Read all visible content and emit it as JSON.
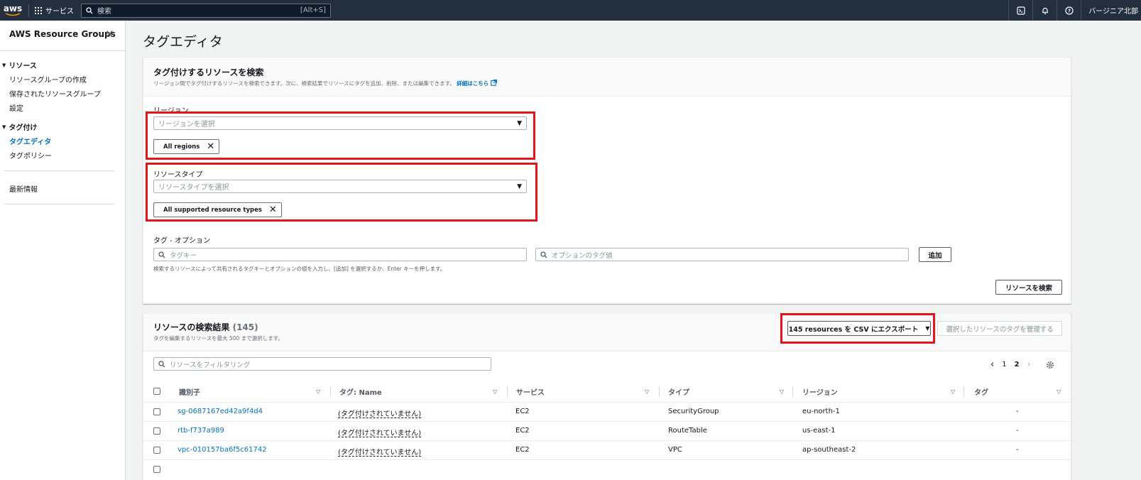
{
  "topnav": {
    "logo": "aws",
    "services_label": "サービス",
    "search_placeholder": "検索",
    "search_shortcut": "[Alt+S]",
    "region": "バージニア北部"
  },
  "sidebar": {
    "title": "AWS Resource Groups",
    "section1": "リソース",
    "items1": [
      "リソースグループの作成",
      "保存されたリソースグループ",
      "設定"
    ],
    "section2": "タグ付け",
    "items2": [
      "タグエディタ",
      "タグポリシー"
    ],
    "extra": "最新情報"
  },
  "page_title": "タグエディタ",
  "search_panel": {
    "title": "タグ付けするリソースを検索",
    "desc": "リージョン間でタグ付けするリソースを検索できます。次に、検索結果でリソースにタグを追加、削除、または編集できます。",
    "desc_link": "詳細はこちら",
    "region_label": "リージョン",
    "region_placeholder": "リージョンを選択",
    "region_token": "All regions",
    "rtype_label": "リソースタイプ",
    "rtype_placeholder": "リソースタイプを選択",
    "rtype_token": "All supported resource types",
    "tag_label": "タグ - オプション",
    "tag_key_placeholder": "タグキー",
    "tag_value_placeholder": "オプションのタグ値",
    "add_button": "追加",
    "tag_hint": "検索するリソースによって共有されるタグキーとオプションの値を入力し、[追加] を選択するか、Enter キーを押します。",
    "search_button": "リソースを検索"
  },
  "results_panel": {
    "title": "リソースの検索結果",
    "count": "(145)",
    "desc": "タグを編集するリソースを最大 500 まで選択します。",
    "export_button": "145 resources を CSV にエクスポート",
    "manage_button": "選択したリソースのタグを管理する",
    "filter_placeholder": "リソースをフィルタリング",
    "pages": [
      "1",
      "2"
    ],
    "columns": [
      "識別子",
      "タグ: Name",
      "サービス",
      "タイプ",
      "リージョン",
      "タグ"
    ],
    "rows": [
      [
        "sg-0687167ed42a9f4d4",
        "(タグ付けされていません)",
        "EC2",
        "SecurityGroup",
        "eu-north-1",
        "-"
      ],
      [
        "rtb-f737a989",
        "(タグ付けされていません)",
        "EC2",
        "RouteTable",
        "us-east-1",
        "-"
      ],
      [
        "vpc-010157ba6f5c61742",
        "(タグ付けされていません)",
        "EC2",
        "VPC",
        "ap-southeast-2",
        "-"
      ]
    ]
  },
  "colors": {
    "highlight": "#e3141c",
    "nav_bg": "#232f3e",
    "link": "#0073bb"
  }
}
